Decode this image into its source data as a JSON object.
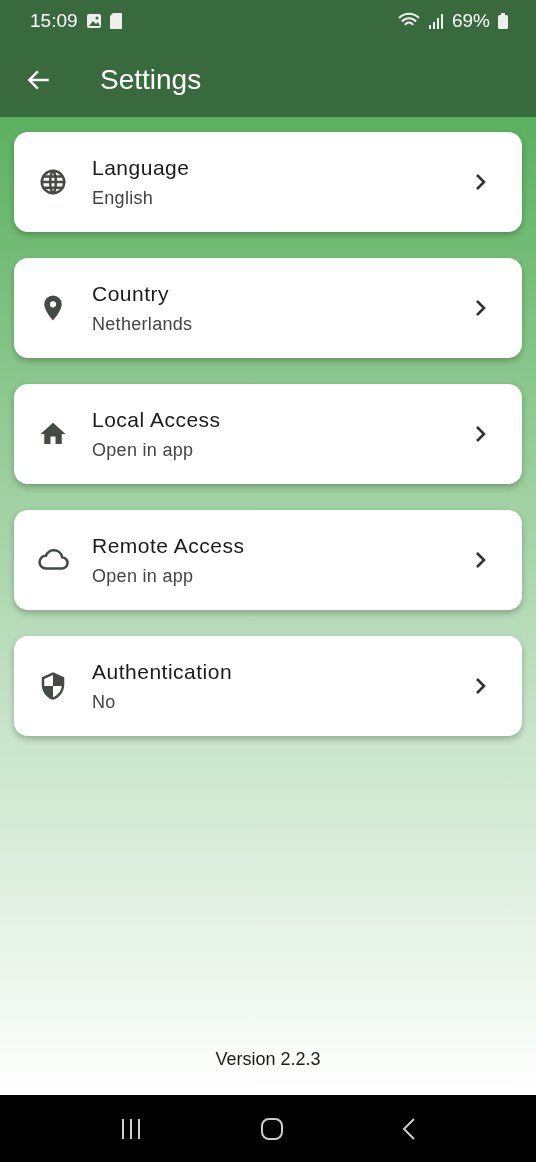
{
  "status_bar": {
    "time": "15:09",
    "battery": "69%"
  },
  "app_bar": {
    "title": "Settings"
  },
  "items": [
    {
      "kind": "globe",
      "title": "Language",
      "value": "English"
    },
    {
      "kind": "pin",
      "title": "Country",
      "value": "Netherlands"
    },
    {
      "kind": "home",
      "title": "Local Access",
      "value": "Open in app"
    },
    {
      "kind": "cloud",
      "title": "Remote Access",
      "value": "Open in app"
    },
    {
      "kind": "shield",
      "title": "Authentication",
      "value": "No"
    }
  ],
  "footer": {
    "version": "Version 2.2.3"
  }
}
